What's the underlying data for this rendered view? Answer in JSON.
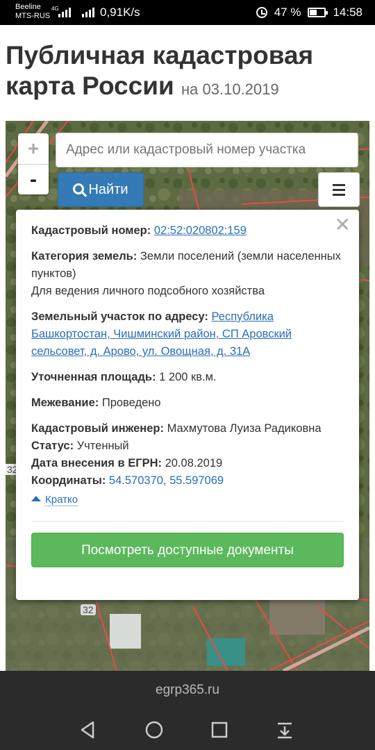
{
  "status_bar": {
    "carrier1": "Beeline",
    "carrier2": "MTS-RUS",
    "network": "4G",
    "speed": "0,91K/s",
    "battery": "47 %",
    "battery_level": 0.47,
    "time": "14:58"
  },
  "header": {
    "title": "Публичная кадастровая карта России",
    "date_prefix": "на",
    "date": "03.10.2019"
  },
  "map": {
    "zoom_in": "+",
    "zoom_out": "-",
    "search_placeholder": "Адрес или кадастровый номер участка",
    "search_button": "Найти",
    "labels": [
      "32",
      "32"
    ]
  },
  "popup": {
    "cadastral_label": "Кадастровый номер:",
    "cadastral_value": "02:52:020802:159",
    "category_label": "Категория земель:",
    "category_value": "Земли поселений (земли населенных пунктов)",
    "usage": "Для ведения личного подсобного хозяйства",
    "address_label": "Земельный участок по адресу:",
    "address_value": "Республика Башкортостан, Чишминский район, СП Аровский сельсовет, д. Арово, ул. Овощная, д. 31А",
    "area_label": "Уточненная площадь:",
    "area_value": "1 200 кв.м.",
    "survey_label": "Межевание:",
    "survey_value": "Проведено",
    "engineer_label": "Кадастровый инженер:",
    "engineer_value": "Махмутова Луиза Радиковна",
    "status_label": "Статус:",
    "status_value": "Учтенный",
    "egrn_label": "Дата внесения в ЕГРН:",
    "egrn_value": "20.08.2019",
    "coords_label": "Координаты:",
    "coords_value": "54.570370, 55.597069",
    "brief_link": "Кратко",
    "docs_button": "Посмотреть доступные документы"
  },
  "browser": {
    "url": "egrp365.ru"
  },
  "colors": {
    "primary": "#337ab7",
    "success": "#5cb85c",
    "link": "#2a6ebb"
  }
}
